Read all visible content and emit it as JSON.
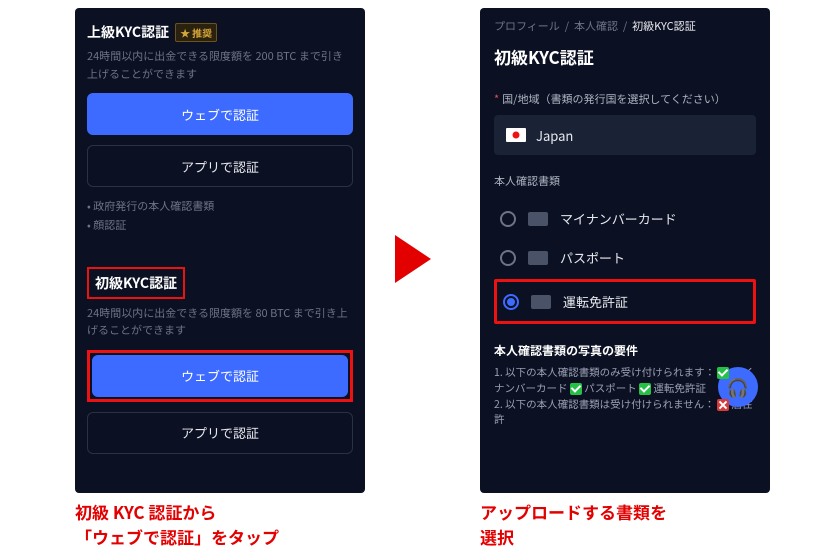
{
  "left": {
    "advanced_title": "上級KYC認証",
    "recommended_badge": "推奨",
    "advanced_desc": "24時間以内に出金できる限度額を 200 BTC まで引き上げることができます",
    "btn_web": "ウェブで認証",
    "btn_app": "アプリで認証",
    "bullet1": "政府発行の本人確認書類",
    "bullet2": "顔認証",
    "basic_title": "初級KYC認証",
    "basic_desc": "24時間以内に出金できる限度額を 80 BTC まで引き上げることができます"
  },
  "right": {
    "crumb1": "プロフィール",
    "crumb2": "本人確認",
    "crumb3": "初級KYC認証",
    "heading": "初級KYC認証",
    "country_label": "国/地域（書類の発行国を選択してください）",
    "country_value": "Japan",
    "doc_sub": "本人確認書類",
    "doc_myna": "マイナンバーカード",
    "doc_pass": "パスポート",
    "doc_drive": "運転免許証",
    "doc_selected": "drive",
    "req_h": "本人確認書類の写真の要件",
    "req1_a": "1. 以下の本人確認書類のみ受け付けられます：",
    "req1_b": "マイナンバーカード",
    "req1_c": "パスポート",
    "req1_d": "運転免許証",
    "req2_a": "2. 以下の本人確認書類は受け付けられません：",
    "req2_b": "居住許"
  },
  "captions": {
    "left": "初級 KYC 認証から\n「ウェブで認証」をタップ",
    "right": "アップロードする書類を\n選択"
  }
}
